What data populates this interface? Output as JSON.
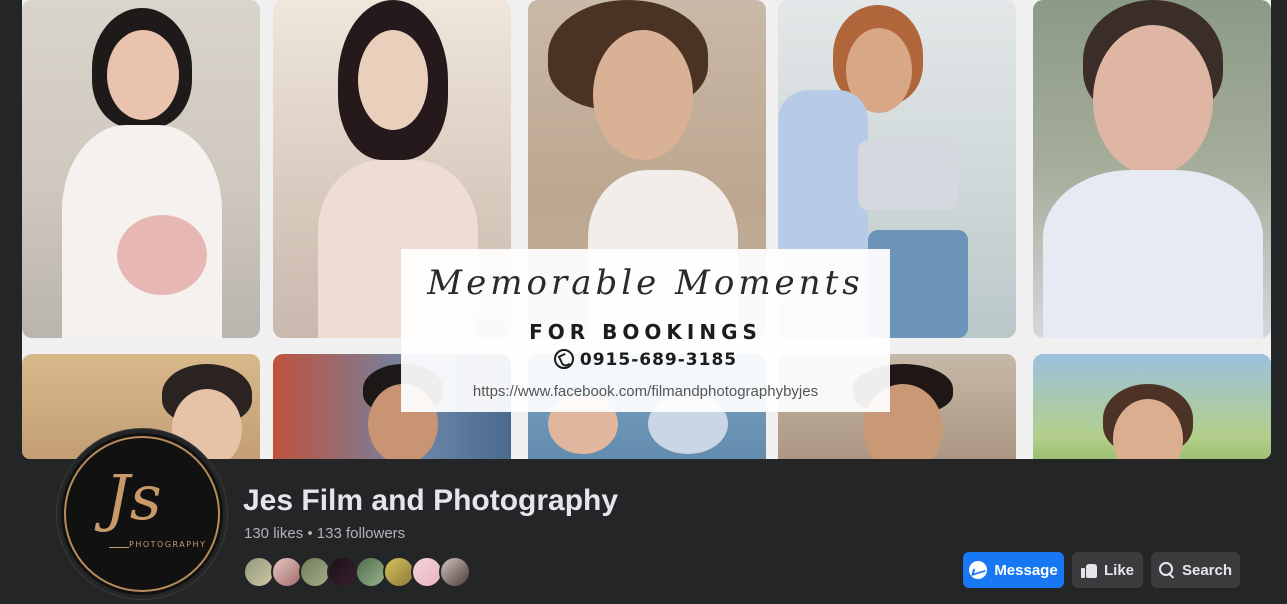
{
  "cover": {
    "overlay_title": "Memorable Moments",
    "overlay_subtitle": "FOR BOOKINGS",
    "overlay_phone": "0915-689-3185",
    "overlay_url": "https://www.facebook.com/filmandphotographybyjes"
  },
  "profile": {
    "logo_letters": "Js",
    "logo_word": "PHOTOGRAPHY",
    "page_name": "Jes Film and Photography",
    "stats": "130 likes • 133 followers"
  },
  "actions": {
    "message_label": "Message",
    "like_label": "Like",
    "search_label": "Search"
  },
  "colors": {
    "background": "#242526",
    "primary_button": "#1877f2",
    "secondary_button": "#3a3b3c",
    "text_primary": "#e4e6eb",
    "text_secondary": "#b0b3b8",
    "logo_gold": "#c9996a"
  },
  "icons": {
    "message": "messenger-icon",
    "like": "thumbs-up-icon",
    "search": "search-icon",
    "phone": "phone-icon"
  }
}
